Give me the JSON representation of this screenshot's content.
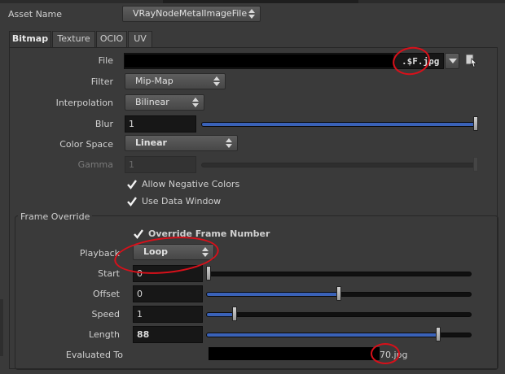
{
  "header": {
    "asset_name_label": "Asset Name",
    "asset_name_value": "VRayNodeMetalImageFile"
  },
  "tabs": [
    {
      "label": "Bitmap",
      "active": true
    },
    {
      "label": "Texture",
      "active": false
    },
    {
      "label": "OCIO",
      "active": false
    },
    {
      "label": "UV",
      "active": false
    }
  ],
  "bitmap": {
    "file_label": "File",
    "file_value_visible": ".$F.jpg",
    "filter_label": "Filter",
    "filter_value": "Mip-Map",
    "interpolation_label": "Interpolation",
    "interpolation_value": "Bilinear",
    "blur_label": "Blur",
    "blur_value": "1",
    "blur_slider_fraction": 1.0,
    "color_space_label": "Color Space",
    "color_space_value": "Linear",
    "gamma_label": "Gamma",
    "gamma_value": "1",
    "allow_negative_label": "Allow Negative Colors",
    "allow_negative_checked": true,
    "use_data_window_label": "Use Data Window",
    "use_data_window_checked": true
  },
  "frame_override": {
    "group_label": "Frame Override",
    "override_label": "Override Frame Number",
    "override_checked": true,
    "playback_label": "Playback",
    "playback_value": "Loop",
    "start_label": "Start",
    "start_value": "0",
    "start_slider_fraction": 0.0,
    "offset_label": "Offset",
    "offset_value": "0",
    "offset_slider_fraction": 0.5,
    "speed_label": "Speed",
    "speed_value": "1",
    "speed_slider_fraction": 0.1,
    "length_label": "Length",
    "length_value": "88",
    "length_slider_fraction": 0.88,
    "evaluated_label": "Evaluated To",
    "evaluated_value_visible": "70.jpg"
  },
  "colors": {
    "panel_bg": "#3a3a3a",
    "field_bg": "#171717",
    "slider_fill": "#3a62b8",
    "annotation_red": "#d8101a"
  }
}
